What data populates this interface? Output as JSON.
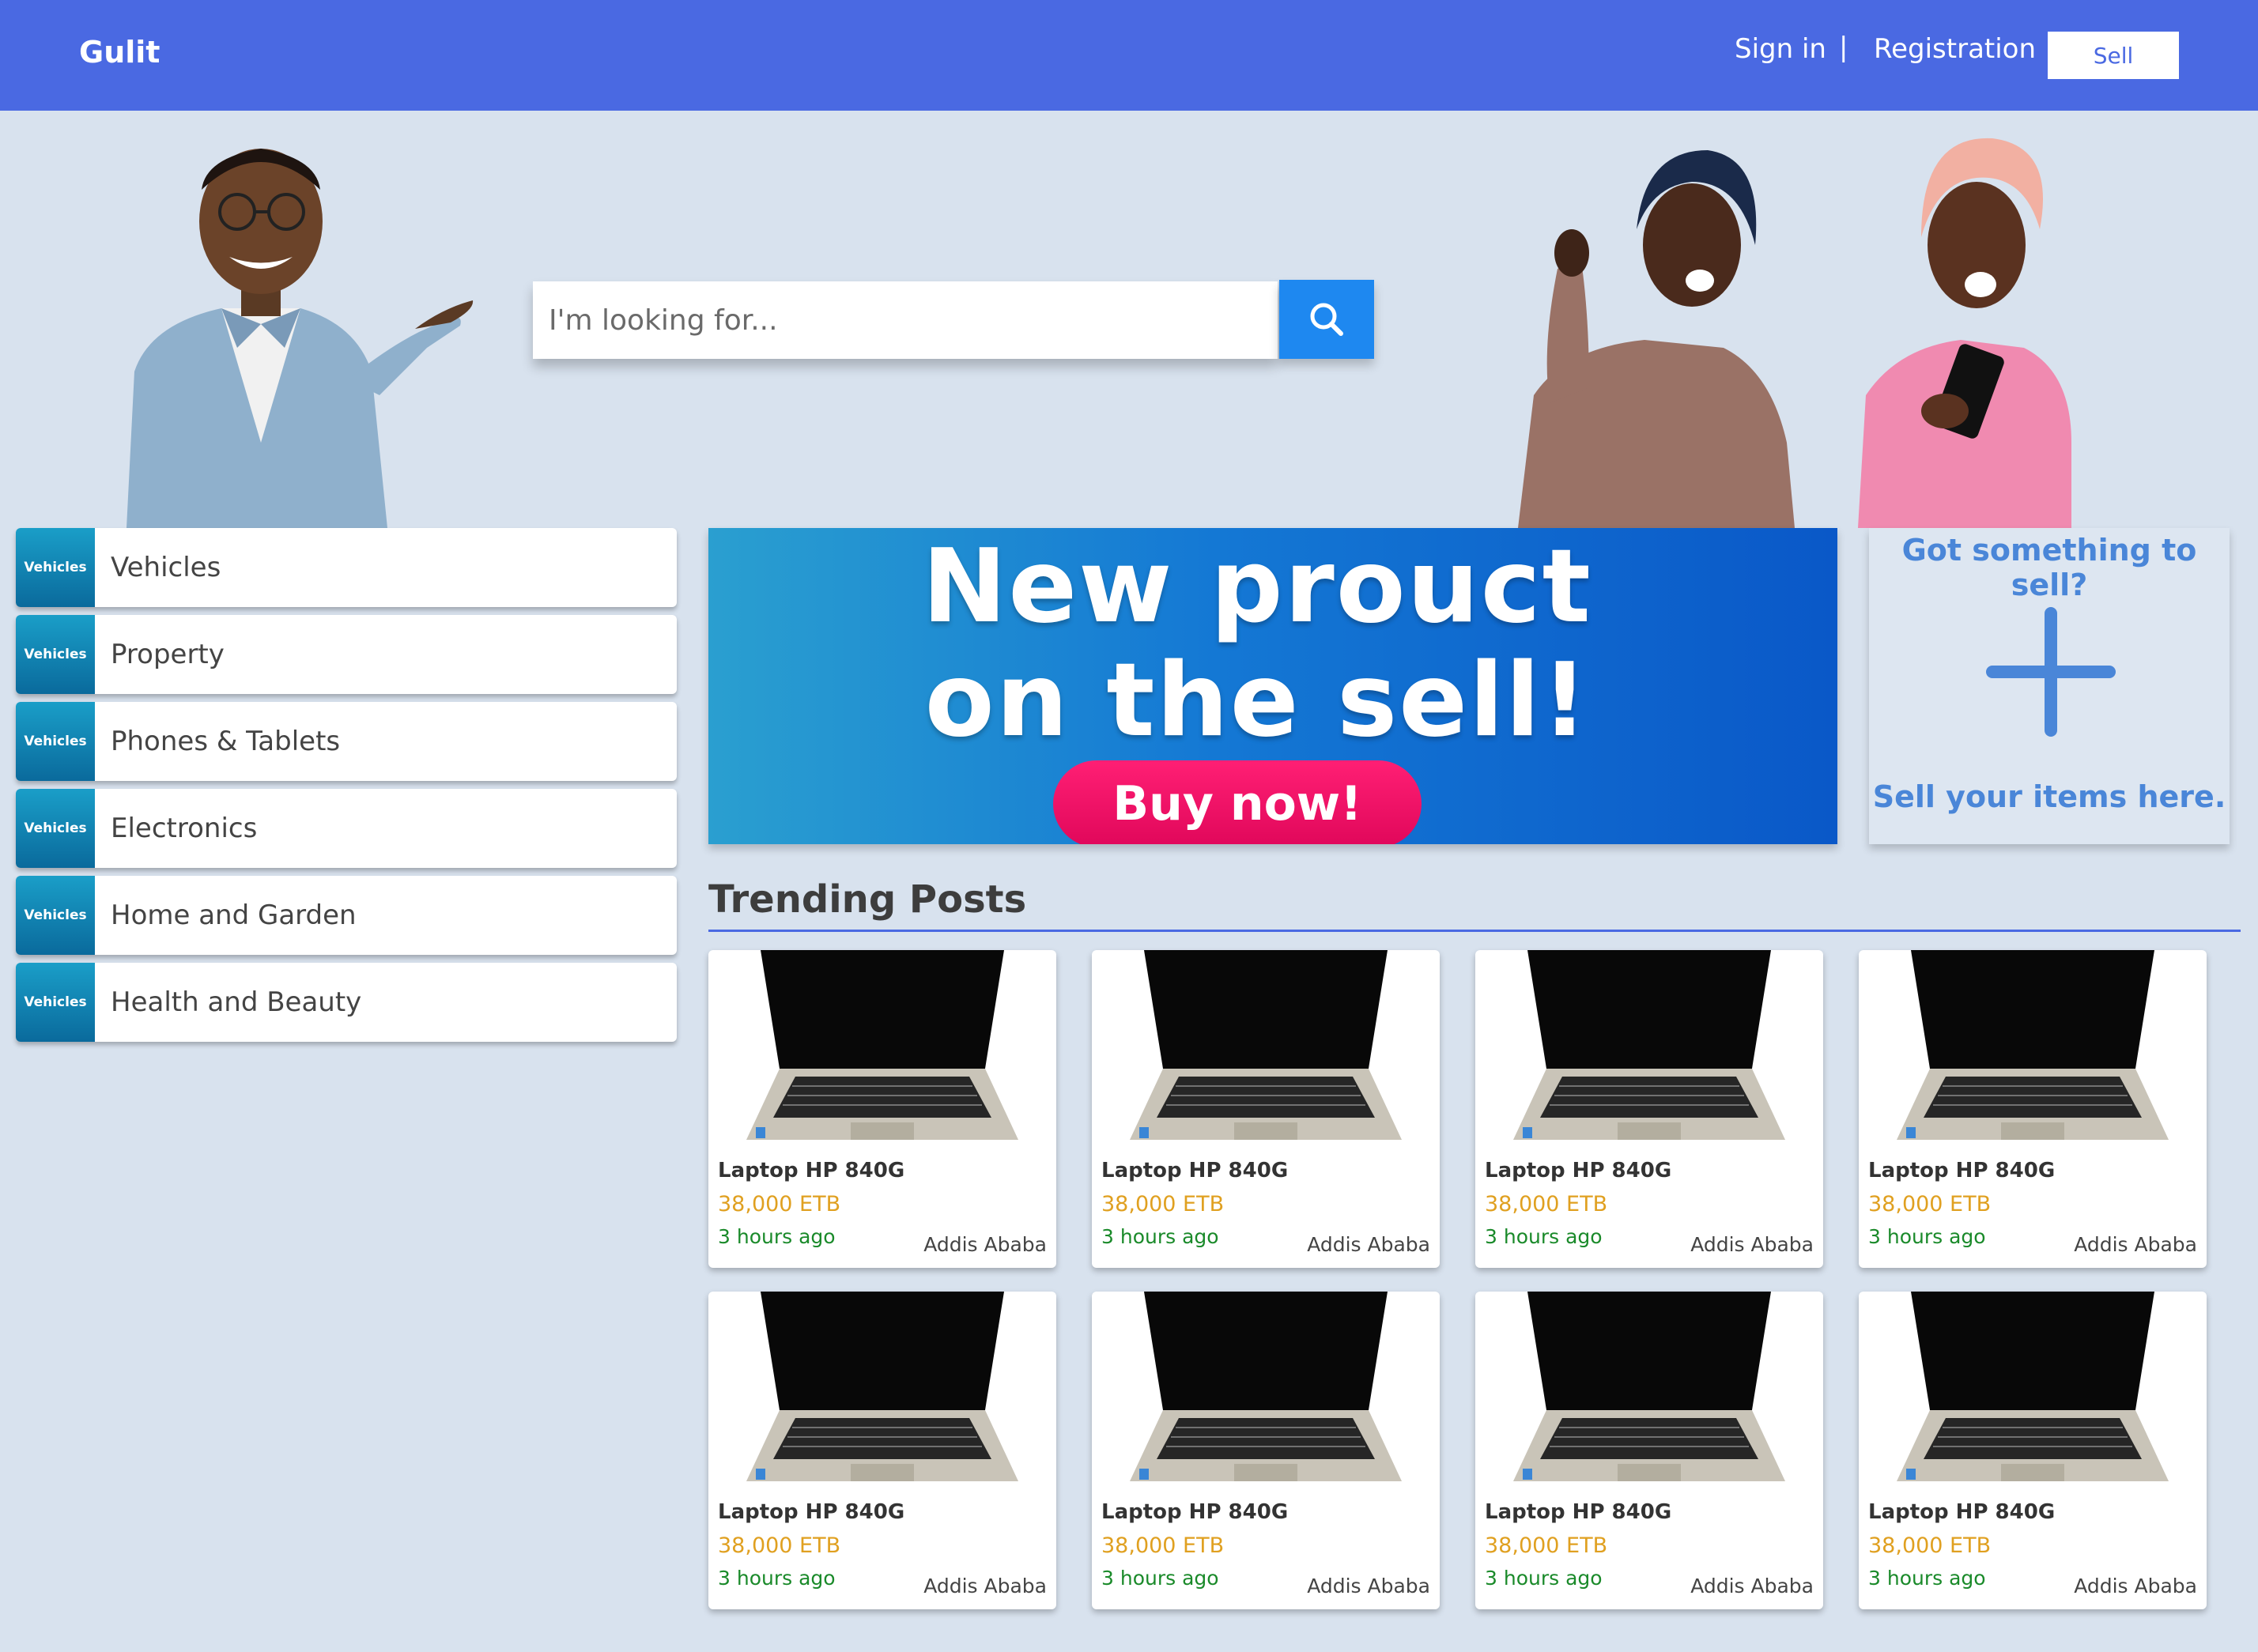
{
  "header": {
    "brand": "Gulit",
    "signin_label": "Sign in",
    "separator": "|",
    "registration_label": "Registration",
    "sell_label": "Sell",
    "color": "#4a69e2"
  },
  "search": {
    "placeholder": "I'm looking for...",
    "button_icon": "search-icon"
  },
  "categories": {
    "badge_text": "Vehicles",
    "items": [
      {
        "label": "Vehicles"
      },
      {
        "label": "Property"
      },
      {
        "label": "Phones & Tablets"
      },
      {
        "label": "Electronics"
      },
      {
        "label": "Home and Garden"
      },
      {
        "label": "Health and Beauty"
      }
    ]
  },
  "banner": {
    "line1": "New prouct",
    "line2": "on the sell!",
    "cta": "Buy now!"
  },
  "sell_panel": {
    "title": "Got something to sell?",
    "icon": "plus-icon",
    "cta": "Sell your items here."
  },
  "trending": {
    "title": "Trending Posts",
    "posts": [
      {
        "title": "Laptop HP 840G",
        "price": "38,000 ETB",
        "time": "3 hours ago",
        "location": "Addis Ababa"
      },
      {
        "title": "Laptop HP 840G",
        "price": "38,000 ETB",
        "time": "3 hours ago",
        "location": "Addis Ababa"
      },
      {
        "title": "Laptop HP 840G",
        "price": "38,000 ETB",
        "time": "3 hours ago",
        "location": "Addis Ababa"
      },
      {
        "title": "Laptop HP 840G",
        "price": "38,000 ETB",
        "time": "3 hours ago",
        "location": "Addis Ababa"
      },
      {
        "title": "Laptop HP 840G",
        "price": "38,000 ETB",
        "time": "3 hours ago",
        "location": "Addis Ababa"
      },
      {
        "title": "Laptop HP 840G",
        "price": "38,000 ETB",
        "time": "3 hours ago",
        "location": "Addis Ababa"
      },
      {
        "title": "Laptop HP 840G",
        "price": "38,000 ETB",
        "time": "3 hours ago",
        "location": "Addis Ababa"
      },
      {
        "title": "Laptop HP 840G",
        "price": "38,000 ETB",
        "time": "3 hours ago",
        "location": "Addis Ababa"
      }
    ]
  }
}
